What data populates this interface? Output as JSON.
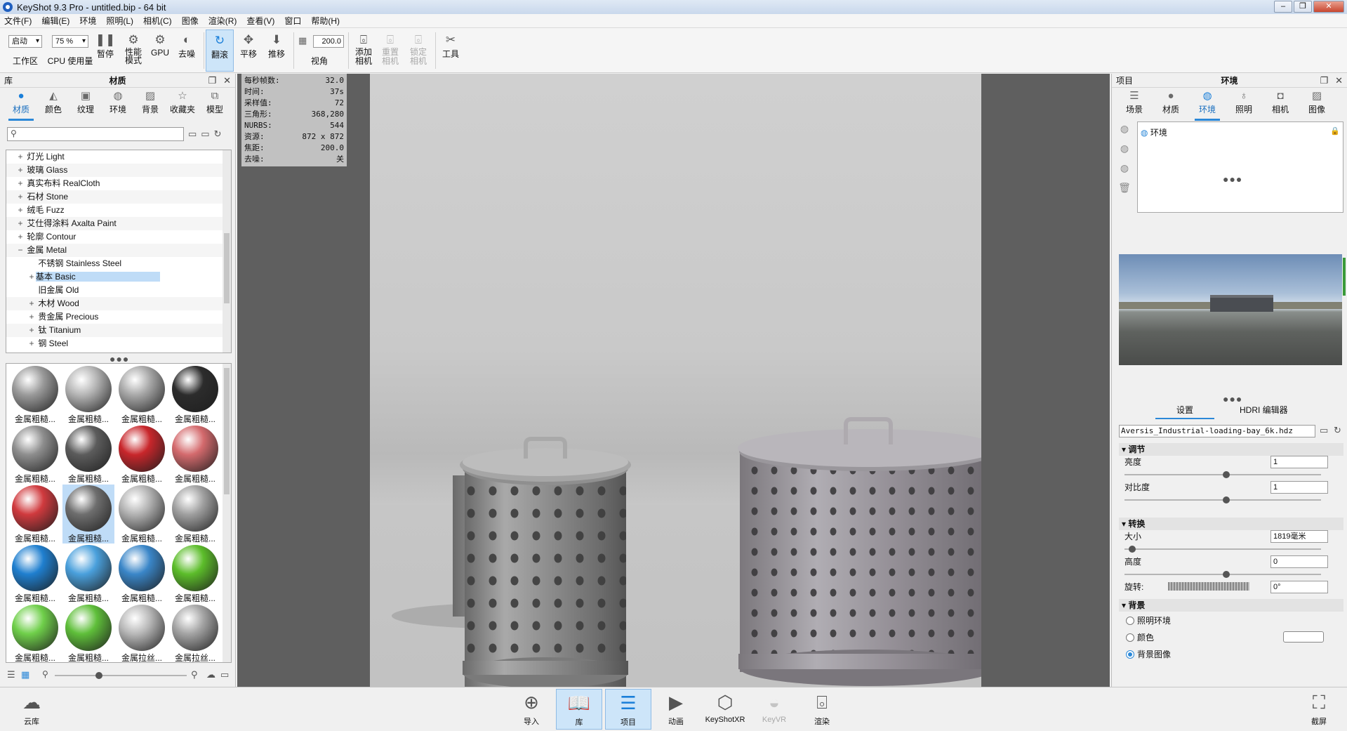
{
  "window": {
    "title": "KeyShot 9.3 Pro  - untitled.bip  - 64 bit"
  },
  "menu": [
    "文件(F)",
    "编辑(E)",
    "环境",
    "照明(L)",
    "相机(C)",
    "图像",
    "渲染(R)",
    "查看(V)",
    "窗口",
    "帮助(H)"
  ],
  "toolbar": {
    "workspace_value": "启动",
    "workspace_label": "工作区",
    "cpu_value": "75 %",
    "cpu_label": "CPU 使用量",
    "pause_label": "暂停",
    "perf_label1": "性能",
    "perf_label2": "模式",
    "gpu_label": "GPU",
    "denoise_label": "去噪",
    "tumble_label": "翻滚",
    "pan_label": "平移",
    "dolly_label": "推移",
    "fov_value": "200.0",
    "fov_label": "视角",
    "add_camera_label1": "添加",
    "add_camera_label2": "相机",
    "reset_camera_label1": "重置",
    "reset_camera_label2": "相机",
    "lock_camera_label1": "锁定",
    "lock_camera_label2": "相机",
    "tools_label": "工具"
  },
  "library": {
    "panel_title": "库",
    "panel_center": "材质",
    "tabs": [
      "材质",
      "颜色",
      "纹理",
      "环境",
      "背景",
      "收藏夹",
      "模型"
    ],
    "tree": [
      {
        "exp": "+",
        "label": "灯光 Light"
      },
      {
        "exp": "+",
        "label": "玻璃 Glass"
      },
      {
        "exp": "+",
        "label": "真实布料 RealCloth"
      },
      {
        "exp": "+",
        "label": "石材 Stone"
      },
      {
        "exp": "+",
        "label": "绒毛 Fuzz"
      },
      {
        "exp": "+",
        "label": "艾仕得涂料 Axalta Paint"
      },
      {
        "exp": "+",
        "label": "轮廓 Contour"
      },
      {
        "exp": "−",
        "label": "金属 Metal"
      },
      {
        "exp": "",
        "label": "不锈钢 Stainless Steel"
      },
      {
        "exp": "+",
        "label": "基本 Basic"
      },
      {
        "exp": "",
        "label": "旧金属 Old"
      },
      {
        "exp": "+",
        "label": "木材 Wood"
      },
      {
        "exp": "+",
        "label": "贵金属 Precious"
      },
      {
        "exp": "+",
        "label": "钛 Titanium"
      },
      {
        "exp": "+",
        "label": "钢 Steel"
      }
    ],
    "thumbs": [
      {
        "label": "金属粗糙...",
        "color": "#9a9a9a"
      },
      {
        "label": "金属粗糙...",
        "color": "#b5b5b5"
      },
      {
        "label": "金属粗糙...",
        "color": "#a8a8a8"
      },
      {
        "label": "金属粗糙...",
        "color": "#2c2c2c"
      },
      {
        "label": "金属粗糙...",
        "color": "#8e8e8e"
      },
      {
        "label": "金属粗糙...",
        "color": "#5c5c5c"
      },
      {
        "label": "金属粗糙...",
        "color": "#c8262b"
      },
      {
        "label": "金属粗糙...",
        "color": "#d46a6d"
      },
      {
        "label": "金属粗糙...",
        "color": "#d03a3e"
      },
      {
        "label": "金属粗糙...",
        "color": "#6e6e6e"
      },
      {
        "label": "金属粗糙...",
        "color": "#b2b2b2"
      },
      {
        "label": "金属粗糙...",
        "color": "#a0a0a0"
      },
      {
        "label": "金属粗糙...",
        "color": "#1f7fcf"
      },
      {
        "label": "金属粗糙...",
        "color": "#4aa0dc"
      },
      {
        "label": "金属粗糙...",
        "color": "#3a86c8"
      },
      {
        "label": "金属粗糙...",
        "color": "#5cbd2a"
      },
      {
        "label": "金属粗糙...",
        "color": "#6fcf4a"
      },
      {
        "label": "金属粗糙...",
        "color": "#5fbf3a"
      },
      {
        "label": "金属拉丝...",
        "color": "#b8b8b8"
      },
      {
        "label": "金属拉丝...",
        "color": "#a4a4a4"
      }
    ]
  },
  "hud": [
    {
      "k": "每秒帧数:",
      "v": "32.0"
    },
    {
      "k": "时间:",
      "v": "37s"
    },
    {
      "k": "采样值:",
      "v": "72"
    },
    {
      "k": "三角形:",
      "v": "368,280"
    },
    {
      "k": "NURBS:",
      "v": "544"
    },
    {
      "k": "资源:",
      "v": "872 x 872"
    },
    {
      "k": "焦距:",
      "v": "200.0"
    },
    {
      "k": "去噪:",
      "v": "关"
    }
  ],
  "project": {
    "panel_title": "项目",
    "panel_center": "环境",
    "tabs": [
      "场景",
      "材质",
      "环境",
      "照明",
      "相机",
      "图像"
    ],
    "env_item": "环境",
    "subtab_settings": "设置",
    "subtab_hdri": "HDRI 编辑器",
    "hdri_file": "Aversis_Industrial-loading-bay_6k.hdz",
    "sec_adjust": "调节",
    "brightness_label": "亮度",
    "brightness_value": "1",
    "contrast_label": "对比度",
    "contrast_value": "1",
    "sec_transform": "转换",
    "size_label": "大小",
    "size_value": "1819毫米",
    "height_label": "高度",
    "height_value": "0",
    "rotation_label": "旋转:",
    "rotation_value": "0°",
    "sec_background": "背景",
    "bg_lighting": "照明环境",
    "bg_color": "颜色",
    "bg_image": "背景图像"
  },
  "bottombar": {
    "cloud": "云库",
    "import": "导入",
    "library": "库",
    "project": "项目",
    "animation": "动画",
    "keyshotxr": "KeyShotXR",
    "keyvr": "KeyVR",
    "render": "渲染",
    "screenshot": "截屏"
  }
}
